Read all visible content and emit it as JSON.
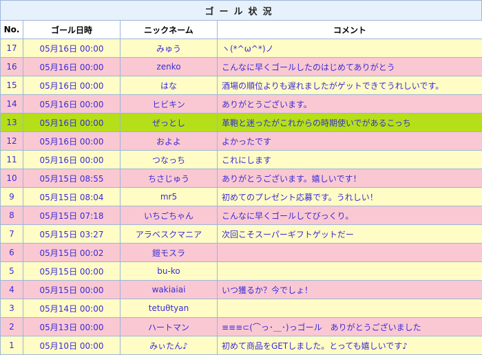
{
  "title": "ゴール状況",
  "headers": {
    "no": "No.",
    "date": "ゴール日時",
    "nick": "ニックネーム",
    "comment": "コメント"
  },
  "rows": [
    {
      "no": "17",
      "date": "05月16日 00:00",
      "nick": "みゅう",
      "comment": "ヽ(*^ω^*)ノ",
      "style": "odd"
    },
    {
      "no": "16",
      "date": "05月16日 00:00",
      "nick": "zenko",
      "comment": "こんなに早くゴールしたのはじめてありがとう",
      "style": "even"
    },
    {
      "no": "15",
      "date": "05月16日 00:00",
      "nick": "はな",
      "comment": "酒場の順位よりも遅れましたがゲットできてうれしいです。",
      "style": "odd"
    },
    {
      "no": "14",
      "date": "05月16日 00:00",
      "nick": "ヒビキン",
      "comment": "ありがとうございます。",
      "style": "even"
    },
    {
      "no": "13",
      "date": "05月16日 00:00",
      "nick": "ぜっとし",
      "comment": "革鞄と迷ったがこれからの時期使いでがあるこっち",
      "style": "hl"
    },
    {
      "no": "12",
      "date": "05月16日 00:00",
      "nick": "およよ",
      "comment": "よかったです",
      "style": "even"
    },
    {
      "no": "11",
      "date": "05月16日 00:00",
      "nick": "つなっち",
      "comment": "これにします",
      "style": "odd"
    },
    {
      "no": "10",
      "date": "05月15日 08:55",
      "nick": "ちさじゅう",
      "comment": "ありがとうございます。嬉しいです！",
      "style": "even"
    },
    {
      "no": "9",
      "date": "05月15日 08:04",
      "nick": "mr5",
      "comment": "初めてのプレゼント応募です。うれしい！",
      "style": "odd"
    },
    {
      "no": "8",
      "date": "05月15日 07:18",
      "nick": "いちごちゃん",
      "comment": "こんなに早くゴールしてびっくり。",
      "style": "even"
    },
    {
      "no": "7",
      "date": "05月15日 03:27",
      "nick": "アラベスクマニア",
      "comment": "次回こそスーパーギフトゲットだー",
      "style": "odd"
    },
    {
      "no": "6",
      "date": "05月15日 00:02",
      "nick": "鎧モスラ",
      "comment": "",
      "style": "even"
    },
    {
      "no": "5",
      "date": "05月15日 00:00",
      "nick": "bu-ko",
      "comment": "",
      "style": "odd"
    },
    {
      "no": "4",
      "date": "05月15日 00:00",
      "nick": "wakiaiai",
      "comment": "いつ獲るか？今でしょ！",
      "style": "even"
    },
    {
      "no": "3",
      "date": "05月14日 00:00",
      "nick": "tetuθtyan",
      "comment": "",
      "style": "odd"
    },
    {
      "no": "2",
      "date": "05月13日 00:00",
      "nick": "ハートマン",
      "comment": "≡≡≡⊂(⌒っ･＿･)っゴール　ありがとうございました",
      "style": "even"
    },
    {
      "no": "1",
      "date": "05月10日 00:00",
      "nick": "みぃたん♪",
      "comment": "初めて商品をGETしました。とっても嬉しいです♪",
      "style": "odd"
    }
  ],
  "colors": {
    "odd": "#fffcc6",
    "even": "#f9c8d2",
    "highlight": "#b5df19",
    "text": "#3a2bd6",
    "border": "#9bb6d8"
  }
}
